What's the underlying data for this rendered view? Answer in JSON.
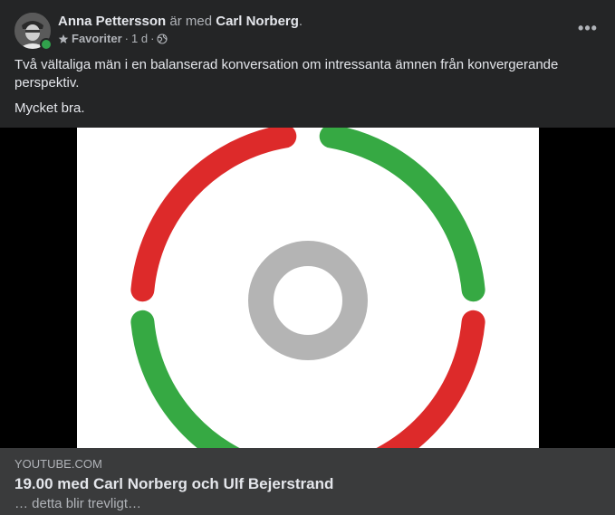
{
  "header": {
    "author": "Anna Pettersson",
    "with_text": "är med",
    "tagged": "Carl Norberg",
    "period": ".",
    "audience": "Favoriter",
    "separator": "·",
    "time": "1 d",
    "more_label": "•••"
  },
  "post": {
    "paragraph1": "Två vältaliga män i en balanserad konversation om intressanta ämnen från konvergerande perspektiv.",
    "paragraph2": "Mycket bra."
  },
  "link_preview": {
    "domain": "YOUTUBE.COM",
    "title": "19.00 med Carl Norberg och Ulf Bejerstrand",
    "description": "… detta blir trevligt…"
  },
  "colors": {
    "background": "#242526",
    "link_background": "#3a3b3c",
    "logo_red": "#dd2a2a",
    "logo_green": "#36a943",
    "logo_gray": "#b4b4b4",
    "online": "#31a24c"
  },
  "icons": {
    "audience": "star-icon",
    "privacy": "globe-icon",
    "menu": "more-icon"
  }
}
